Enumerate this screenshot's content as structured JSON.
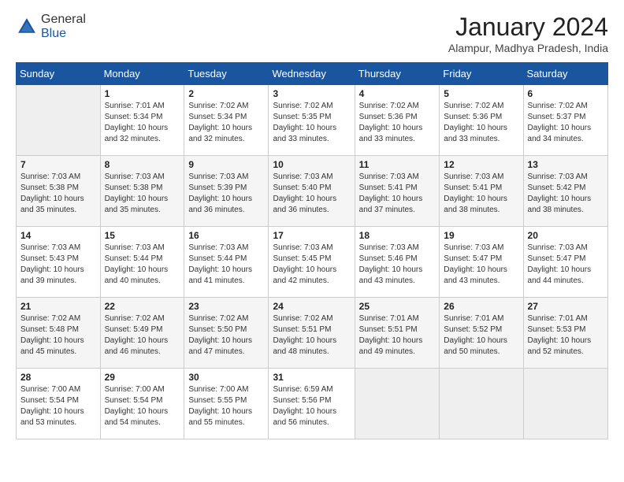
{
  "header": {
    "logo_general": "General",
    "logo_blue": "Blue",
    "month_title": "January 2024",
    "subtitle": "Alampur, Madhya Pradesh, India"
  },
  "days_of_week": [
    "Sunday",
    "Monday",
    "Tuesday",
    "Wednesday",
    "Thursday",
    "Friday",
    "Saturday"
  ],
  "weeks": [
    [
      {
        "day": "",
        "empty": true
      },
      {
        "day": "1",
        "sunrise": "7:01 AM",
        "sunset": "5:34 PM",
        "daylight": "10 hours and 32 minutes."
      },
      {
        "day": "2",
        "sunrise": "7:02 AM",
        "sunset": "5:34 PM",
        "daylight": "10 hours and 32 minutes."
      },
      {
        "day": "3",
        "sunrise": "7:02 AM",
        "sunset": "5:35 PM",
        "daylight": "10 hours and 33 minutes."
      },
      {
        "day": "4",
        "sunrise": "7:02 AM",
        "sunset": "5:36 PM",
        "daylight": "10 hours and 33 minutes."
      },
      {
        "day": "5",
        "sunrise": "7:02 AM",
        "sunset": "5:36 PM",
        "daylight": "10 hours and 33 minutes."
      },
      {
        "day": "6",
        "sunrise": "7:02 AM",
        "sunset": "5:37 PM",
        "daylight": "10 hours and 34 minutes."
      }
    ],
    [
      {
        "day": "7",
        "sunrise": "7:03 AM",
        "sunset": "5:38 PM",
        "daylight": "10 hours and 35 minutes."
      },
      {
        "day": "8",
        "sunrise": "7:03 AM",
        "sunset": "5:38 PM",
        "daylight": "10 hours and 35 minutes."
      },
      {
        "day": "9",
        "sunrise": "7:03 AM",
        "sunset": "5:39 PM",
        "daylight": "10 hours and 36 minutes."
      },
      {
        "day": "10",
        "sunrise": "7:03 AM",
        "sunset": "5:40 PM",
        "daylight": "10 hours and 36 minutes."
      },
      {
        "day": "11",
        "sunrise": "7:03 AM",
        "sunset": "5:41 PM",
        "daylight": "10 hours and 37 minutes."
      },
      {
        "day": "12",
        "sunrise": "7:03 AM",
        "sunset": "5:41 PM",
        "daylight": "10 hours and 38 minutes."
      },
      {
        "day": "13",
        "sunrise": "7:03 AM",
        "sunset": "5:42 PM",
        "daylight": "10 hours and 38 minutes."
      }
    ],
    [
      {
        "day": "14",
        "sunrise": "7:03 AM",
        "sunset": "5:43 PM",
        "daylight": "10 hours and 39 minutes."
      },
      {
        "day": "15",
        "sunrise": "7:03 AM",
        "sunset": "5:44 PM",
        "daylight": "10 hours and 40 minutes."
      },
      {
        "day": "16",
        "sunrise": "7:03 AM",
        "sunset": "5:44 PM",
        "daylight": "10 hours and 41 minutes."
      },
      {
        "day": "17",
        "sunrise": "7:03 AM",
        "sunset": "5:45 PM",
        "daylight": "10 hours and 42 minutes."
      },
      {
        "day": "18",
        "sunrise": "7:03 AM",
        "sunset": "5:46 PM",
        "daylight": "10 hours and 43 minutes."
      },
      {
        "day": "19",
        "sunrise": "7:03 AM",
        "sunset": "5:47 PM",
        "daylight": "10 hours and 43 minutes."
      },
      {
        "day": "20",
        "sunrise": "7:03 AM",
        "sunset": "5:47 PM",
        "daylight": "10 hours and 44 minutes."
      }
    ],
    [
      {
        "day": "21",
        "sunrise": "7:02 AM",
        "sunset": "5:48 PM",
        "daylight": "10 hours and 45 minutes."
      },
      {
        "day": "22",
        "sunrise": "7:02 AM",
        "sunset": "5:49 PM",
        "daylight": "10 hours and 46 minutes."
      },
      {
        "day": "23",
        "sunrise": "7:02 AM",
        "sunset": "5:50 PM",
        "daylight": "10 hours and 47 minutes."
      },
      {
        "day": "24",
        "sunrise": "7:02 AM",
        "sunset": "5:51 PM",
        "daylight": "10 hours and 48 minutes."
      },
      {
        "day": "25",
        "sunrise": "7:01 AM",
        "sunset": "5:51 PM",
        "daylight": "10 hours and 49 minutes."
      },
      {
        "day": "26",
        "sunrise": "7:01 AM",
        "sunset": "5:52 PM",
        "daylight": "10 hours and 50 minutes."
      },
      {
        "day": "27",
        "sunrise": "7:01 AM",
        "sunset": "5:53 PM",
        "daylight": "10 hours and 52 minutes."
      }
    ],
    [
      {
        "day": "28",
        "sunrise": "7:00 AM",
        "sunset": "5:54 PM",
        "daylight": "10 hours and 53 minutes."
      },
      {
        "day": "29",
        "sunrise": "7:00 AM",
        "sunset": "5:54 PM",
        "daylight": "10 hours and 54 minutes."
      },
      {
        "day": "30",
        "sunrise": "7:00 AM",
        "sunset": "5:55 PM",
        "daylight": "10 hours and 55 minutes."
      },
      {
        "day": "31",
        "sunrise": "6:59 AM",
        "sunset": "5:56 PM",
        "daylight": "10 hours and 56 minutes."
      },
      {
        "day": "",
        "empty": true
      },
      {
        "day": "",
        "empty": true
      },
      {
        "day": "",
        "empty": true
      }
    ]
  ]
}
